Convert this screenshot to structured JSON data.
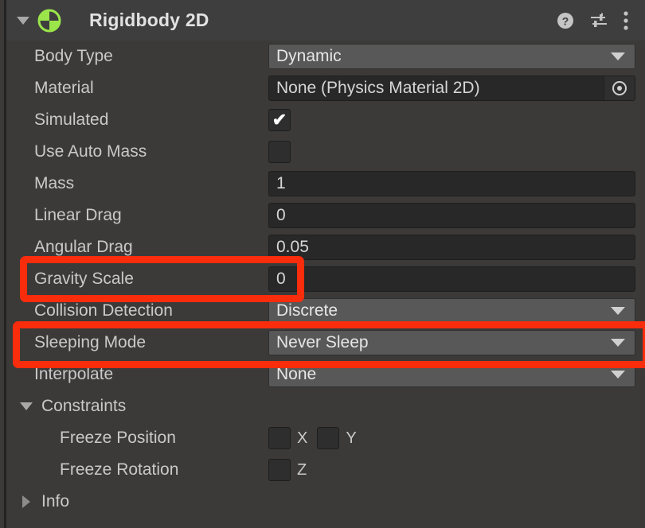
{
  "component": {
    "title": "Rigidbody 2D",
    "icon": "rigidbody2d-icon",
    "foldout_expanded": true,
    "header_icons": [
      {
        "name": "help-icon",
        "label": "?"
      },
      {
        "name": "preset-icon",
        "label": ""
      },
      {
        "name": "more-menu-icon",
        "label": ""
      }
    ]
  },
  "properties": {
    "body_type": {
      "label": "Body Type",
      "value": "Dynamic",
      "control": "dropdown"
    },
    "material": {
      "label": "Material",
      "value": "None (Physics Material 2D)",
      "control": "object-field"
    },
    "simulated": {
      "label": "Simulated",
      "value": true,
      "control": "checkbox"
    },
    "use_auto_mass": {
      "label": "Use Auto Mass",
      "value": false,
      "control": "checkbox"
    },
    "mass": {
      "label": "Mass",
      "value": "1",
      "control": "number"
    },
    "linear_drag": {
      "label": "Linear Drag",
      "value": "0",
      "control": "number"
    },
    "angular_drag": {
      "label": "Angular Drag",
      "value": "0.05",
      "control": "number"
    },
    "gravity_scale": {
      "label": "Gravity Scale",
      "value": "0",
      "control": "number"
    },
    "collision_detection": {
      "label": "Collision Detection",
      "value": "Discrete",
      "control": "dropdown"
    },
    "sleeping_mode": {
      "label": "Sleeping Mode",
      "value": "Never Sleep",
      "control": "dropdown"
    },
    "interpolate": {
      "label": "Interpolate",
      "value": "None",
      "control": "dropdown"
    }
  },
  "constraints": {
    "label": "Constraints",
    "expanded": true,
    "freeze_position": {
      "label": "Freeze Position",
      "axes": [
        {
          "axis": "X",
          "checked": false
        },
        {
          "axis": "Y",
          "checked": false
        }
      ]
    },
    "freeze_rotation": {
      "label": "Freeze Rotation",
      "axes": [
        {
          "axis": "Z",
          "checked": false
        }
      ]
    }
  },
  "info": {
    "label": "Info",
    "expanded": false
  },
  "annotations": [
    {
      "name": "gravity-scale-highlight",
      "target": "Gravity Scale",
      "color": "#f92c0c"
    },
    {
      "name": "sleeping-mode-highlight",
      "target": "Sleeping Mode",
      "color": "#f92c0c"
    }
  ],
  "checkmark_glyph": "✔"
}
